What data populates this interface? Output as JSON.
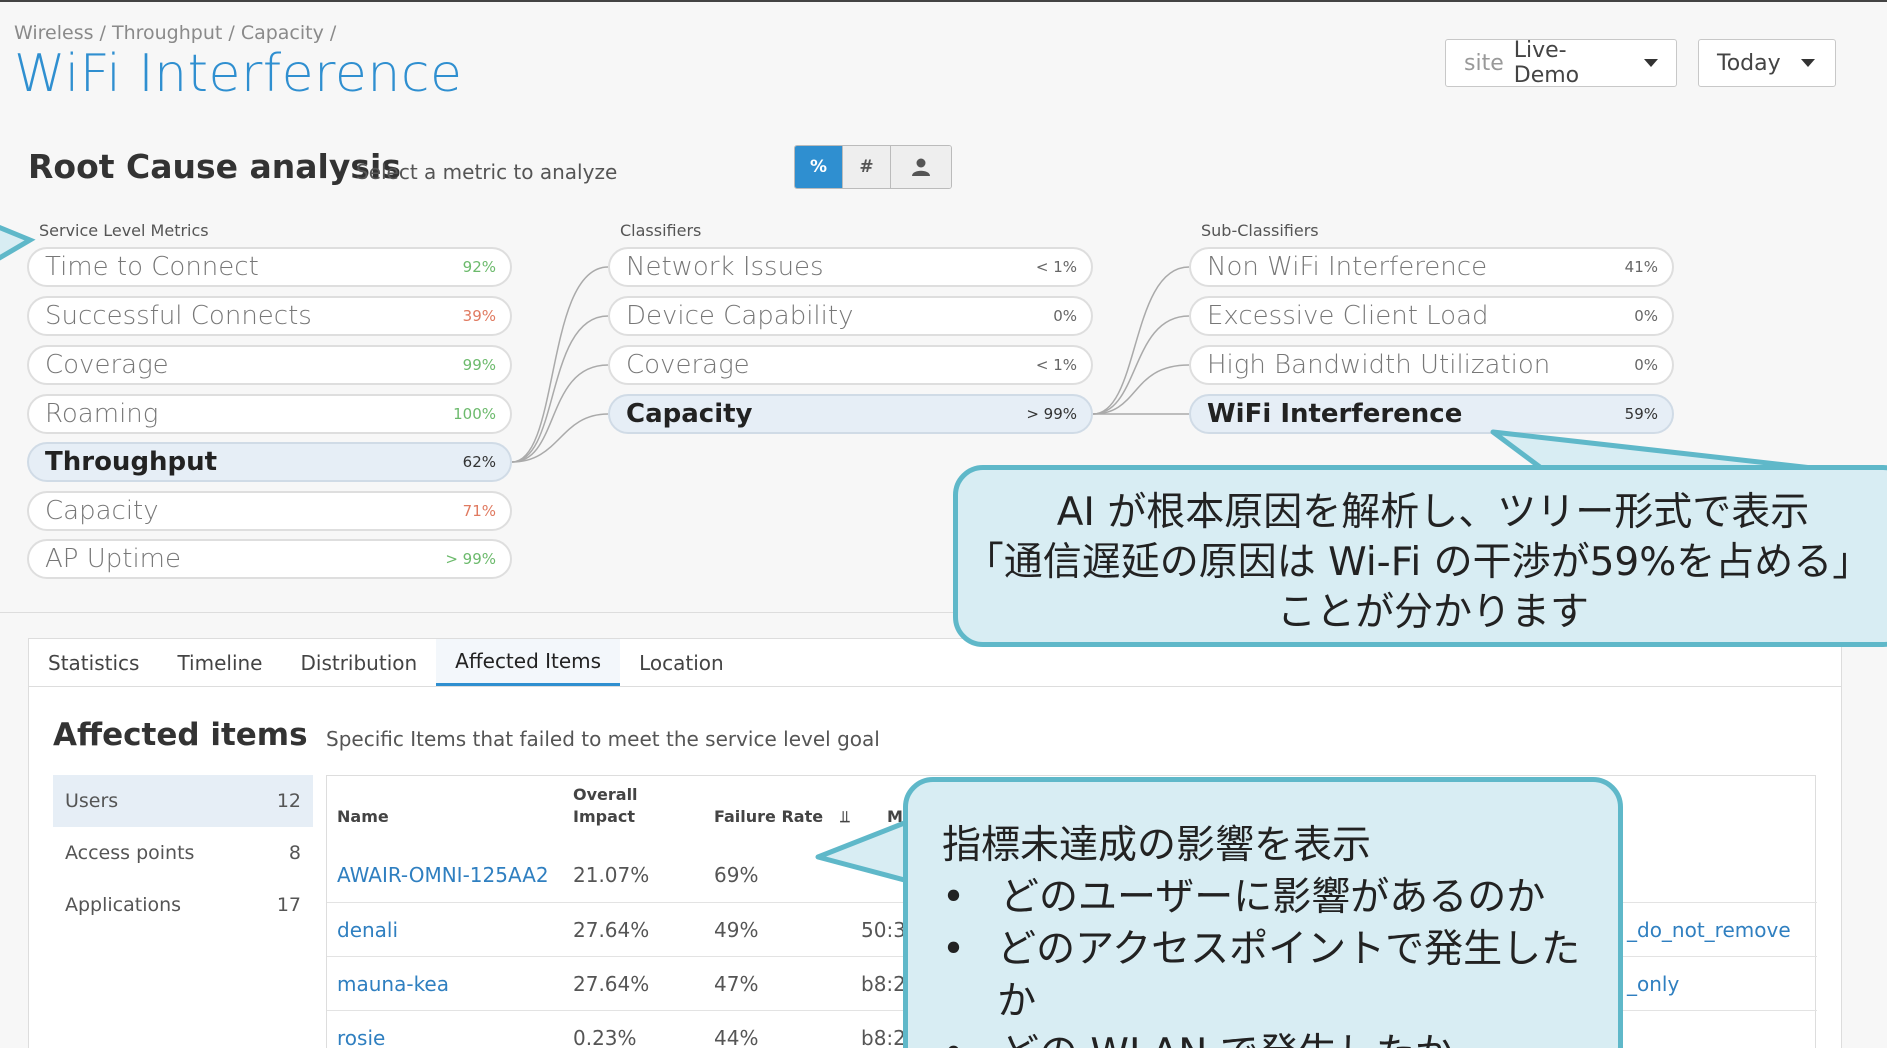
{
  "breadcrumb": "Wireless / Throughput / Capacity /",
  "page_title": "WiFi Interference",
  "site_dropdown": {
    "prefix": "site",
    "value": "Live-Demo"
  },
  "date_dropdown": {
    "value": "Today"
  },
  "rca": {
    "title": "Root Cause analysis",
    "subtitle": "Select a metric to analyze",
    "toggle": {
      "percent": "%",
      "count": "#",
      "user_icon": "user-icon",
      "active": "percent"
    }
  },
  "columns": {
    "slm_header": "Service Level Metrics",
    "classifiers_header": "Classifiers",
    "subclassifiers_header": "Sub-Classifiers"
  },
  "slm": [
    {
      "label": "Time to Connect",
      "pct": "92%",
      "color": "#6cba6c"
    },
    {
      "label": "Successful Connects",
      "pct": "39%",
      "color": "#e07a60"
    },
    {
      "label": "Coverage",
      "pct": "99%",
      "color": "#6cba6c"
    },
    {
      "label": "Roaming",
      "pct": "100%",
      "color": "#6cba6c"
    },
    {
      "label": "Throughput",
      "pct": "62%",
      "color": "#e07a60",
      "selected": true
    },
    {
      "label": "Capacity",
      "pct": "71%",
      "color": "#e07a60"
    },
    {
      "label": "AP Uptime",
      "pct": "> 99%",
      "color": "#6cba6c"
    }
  ],
  "classifiers": [
    {
      "label": "Network Issues",
      "pct": "< 1%"
    },
    {
      "label": "Device Capability",
      "pct": "0%"
    },
    {
      "label": "Coverage",
      "pct": "< 1%"
    },
    {
      "label": "Capacity",
      "pct": "> 99%",
      "selected": true
    }
  ],
  "subclassifiers": [
    {
      "label": "Non WiFi Interference",
      "pct": "41%"
    },
    {
      "label": "Excessive Client Load",
      "pct": "0%"
    },
    {
      "label": "High Bandwidth Utilization",
      "pct": "0%"
    },
    {
      "label": "WiFi Interference",
      "pct": "59%",
      "selected": true
    }
  ],
  "tabs": [
    "Statistics",
    "Timeline",
    "Distribution",
    "Affected Items",
    "Location"
  ],
  "active_tab": "Affected Items",
  "affected": {
    "title": "Affected items",
    "subtitle": "Specific Items that failed to meet the service level goal",
    "categories": [
      {
        "label": "Users",
        "count": "12",
        "active": true
      },
      {
        "label": "Access points",
        "count": "8"
      },
      {
        "label": "Applications",
        "count": "17"
      }
    ],
    "headers": {
      "name": "Name",
      "impact_line1": "Overall",
      "impact_line2": "Impact",
      "failure": "Failure Rate",
      "sort_icon": "sort-desc-icon",
      "mac": "MAC"
    },
    "rows": [
      {
        "name": "AWAIR-OMNI-125AA2",
        "impact": "21.07%",
        "failure": "69%",
        "mac": "",
        "wlan": ""
      },
      {
        "name": "denali",
        "impact": "27.64%",
        "failure": "49%",
        "mac": "50:3",
        "wlan": "_do_not_remove"
      },
      {
        "name": "mauna-kea",
        "impact": "27.64%",
        "failure": "47%",
        "mac": "b8:2",
        "wlan": "_only"
      },
      {
        "name": "rosie",
        "impact": "0.23%",
        "failure": "44%",
        "mac": "b8:2",
        "wlan": ""
      }
    ]
  },
  "callouts": {
    "tree": {
      "line1": "AI が根本原因を解析し、ツリー形式で表示",
      "line2": "「通信遅延の原因は Wi-Fi の干渉が59%を占める」",
      "line3": "ことが分かります"
    },
    "impact": {
      "heading": "指標未達成の影響を表示",
      "bullets": [
        "どのユーザーに影響があるのか",
        "どのアクセスポイントで発生したか",
        "どの WLAN で発生したか"
      ],
      "bullet_char": "•"
    }
  }
}
